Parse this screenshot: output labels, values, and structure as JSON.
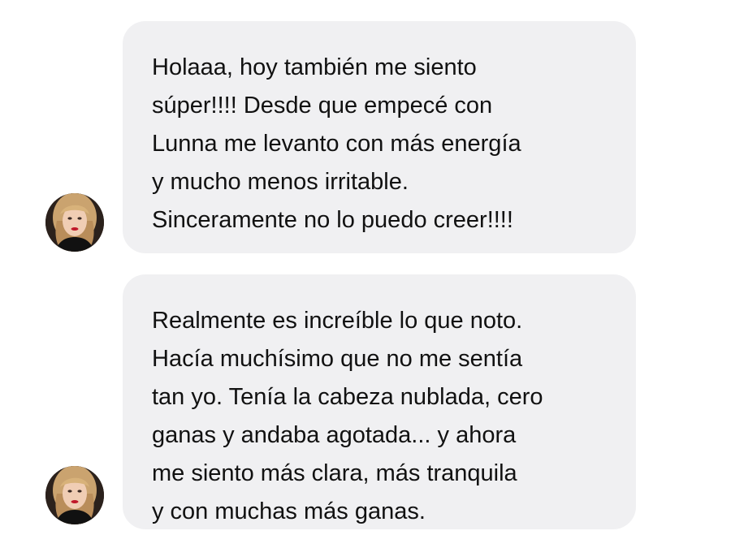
{
  "conversation": {
    "messages": [
      {
        "text": "Holaaa, hoy también me siento\nsúper!!!! Desde que empecé con\nLunna me levanto con más energía\ny mucho menos irritable.\nSinceramente no lo puedo creer!!!!",
        "avatar_icon": "user-avatar-photo"
      },
      {
        "text": "Realmente es increíble lo que noto.\nHacía muchísimo que no me sentía\ntan yo. Tenía la cabeza nublada, cero\nganas y andaba agotada... y ahora\nme siento más clara, más tranquila\ny con muchas más ganas.",
        "avatar_icon": "user-avatar-photo"
      }
    ]
  },
  "colors": {
    "background": "#ffffff",
    "bubble": "#f0f0f2",
    "text": "#111111"
  }
}
